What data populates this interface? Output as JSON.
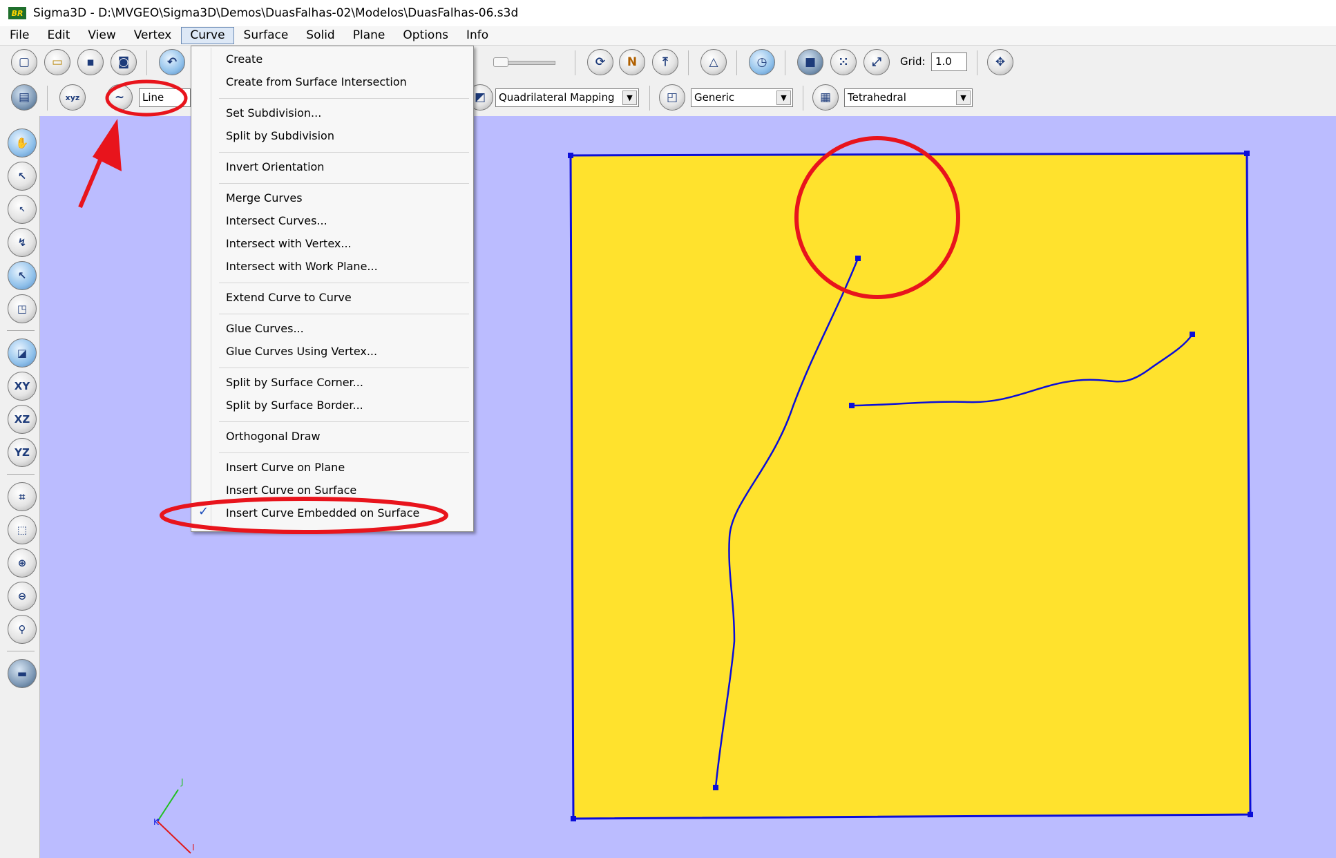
{
  "window": {
    "title": "Sigma3D - D:\\MVGEO\\Sigma3D\\Demos\\DuasFalhas-02\\Modelos\\DuasFalhas-06.s3d",
    "app_icon": "BR"
  },
  "menubar": [
    "File",
    "Edit",
    "View",
    "Vertex",
    "Curve",
    "Surface",
    "Solid",
    "Plane",
    "Options",
    "Info"
  ],
  "active_menu": "Curve",
  "curve_menu": {
    "items": [
      "Create",
      "Create from Surface Intersection",
      "Set Subdivision...",
      "Split by Subdivision",
      "Invert Orientation",
      "Merge Curves",
      "Intersect Curves...",
      "Intersect with Vertex...",
      "Intersect with Work Plane...",
      "Extend Curve to Curve",
      "Glue Curves...",
      "Glue Curves Using Vertex...",
      "Split by Surface Corner...",
      "Split by Surface Border...",
      "Orthogonal Draw",
      "Insert Curve on Plane",
      "Insert Curve on Surface",
      "Insert Curve Embedded on Surface"
    ],
    "checked_item": "Insert Curve Embedded on Surface",
    "check_glyph": "✓"
  },
  "toolbar": {
    "grid_label": "Grid:",
    "grid_value": "1.0",
    "curve_type": "Line",
    "mapping_select": "Quadrilateral Mapping",
    "generic_select": "Generic",
    "mesh_select": "Tetrahedral",
    "xyz_label": "xyz",
    "north_label": "N"
  },
  "left_toolbar": {
    "xy": "XY",
    "xz": "XZ",
    "yz": "YZ"
  },
  "axes": {
    "j": "J",
    "k": "K",
    "i": "I"
  },
  "colors": {
    "viewport_bg": "#bbbcff",
    "surface_fill": "#ffe22d",
    "curve_color": "#0b0ed8",
    "annotation": "#e8141c",
    "menu_bg": "#f7f7f7"
  }
}
